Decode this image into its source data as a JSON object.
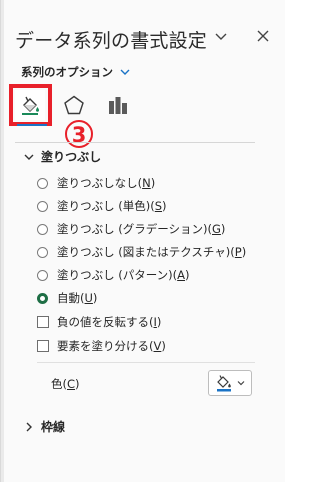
{
  "pane": {
    "title": "データ系列の書式設定",
    "series_options_label": "系列のオプション"
  },
  "step_badge": "3",
  "icons": {
    "fill_line": "paint-bucket-icon",
    "effects": "pentagon-icon",
    "series_options": "bar-chart-icon"
  },
  "fill_section": {
    "heading": "塗りつぶし",
    "options": [
      {
        "label": "塗りつぶしなし(",
        "key": "N",
        "tail": ")",
        "selected": false
      },
      {
        "label": "塗りつぶし (単色)(",
        "key": "S",
        "tail": ")",
        "selected": false
      },
      {
        "label": "塗りつぶし (グラデーション)(",
        "key": "G",
        "tail": ")",
        "selected": false
      },
      {
        "label": "塗りつぶし (図またはテクスチャ)(",
        "key": "P",
        "tail": ")",
        "selected": false
      },
      {
        "label": "塗りつぶし (パターン)(",
        "key": "A",
        "tail": ")",
        "selected": false
      },
      {
        "label": "自動(",
        "key": "U",
        "tail": ")",
        "selected": true
      }
    ],
    "checkboxes": [
      {
        "label": "負の値を反転する(",
        "key": "I",
        "tail": ")",
        "checked": false
      },
      {
        "label": "要素を塗り分ける(",
        "key": "V",
        "tail": ")",
        "checked": false
      }
    ],
    "color_label": "色(",
    "color_key": "C",
    "color_tail": ")"
  },
  "border_section": {
    "heading": "枠線"
  },
  "colors": {
    "accent_blue": "#1a73c6",
    "highlight_red": "#e8202a",
    "selected_radio": "#1e6e45"
  }
}
